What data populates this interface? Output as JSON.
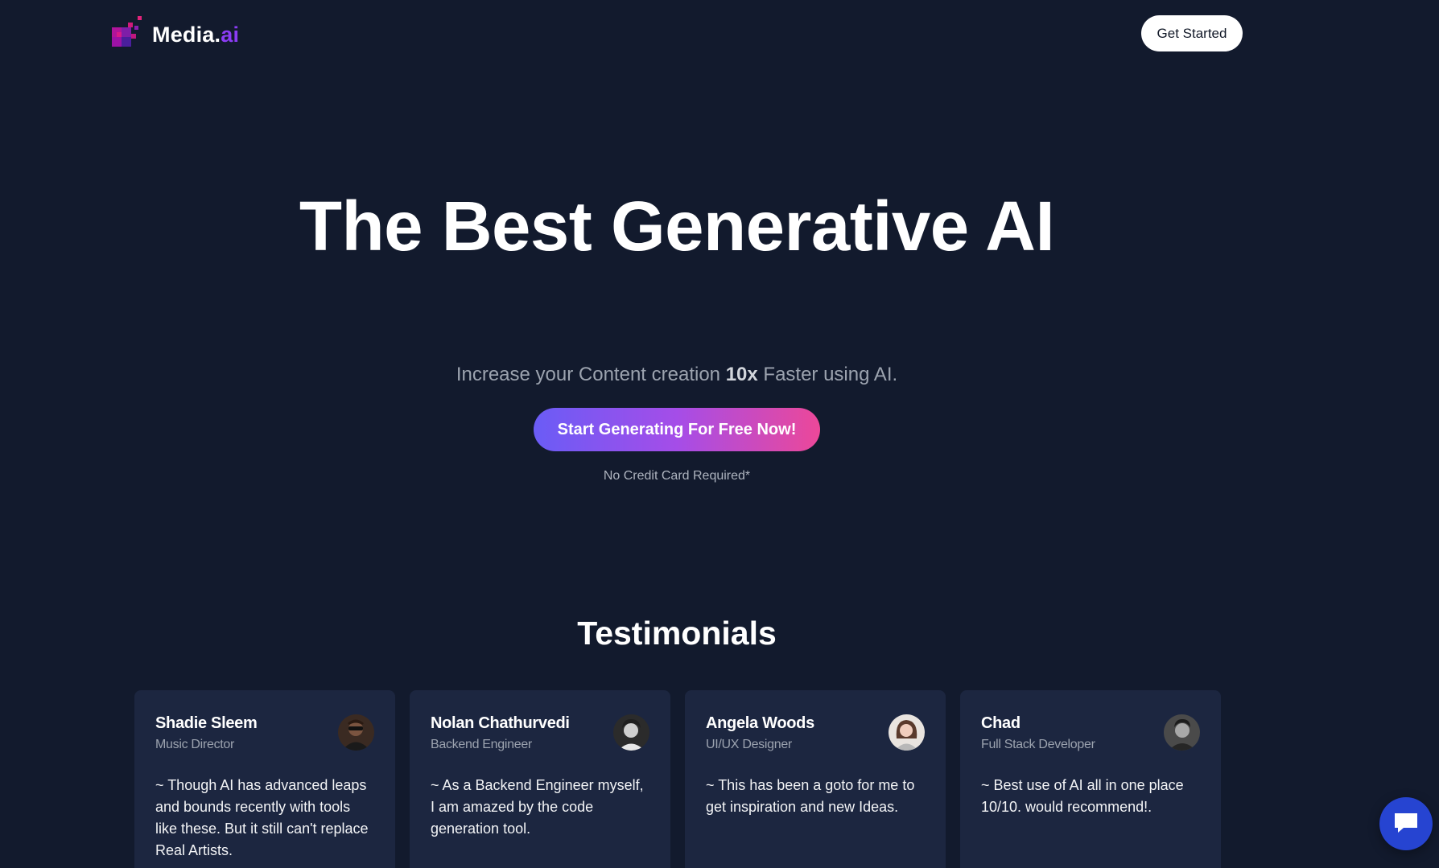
{
  "brand": {
    "name_main": "Media.",
    "name_accent": "ai",
    "accent_color": "#8b3cf5",
    "logo_icon": "pixel-logo-icon"
  },
  "header": {
    "get_started_label": "Get Started"
  },
  "hero": {
    "title": "The Best Generative AI",
    "subtitle_before": "Increase your Content creation ",
    "subtitle_bold": "10x",
    "subtitle_after": " Faster using AI.",
    "cta_label": "Start Generating For Free Now!",
    "cta_gradient": [
      "#6a5cf6",
      "#a54de8",
      "#ec4899"
    ],
    "note": "No Credit Card Required*"
  },
  "testimonials": {
    "title": "Testimonials",
    "items": [
      {
        "name": "Shadie Sleem",
        "role": "Music Director",
        "text": "~ Though AI has advanced leaps and bounds recently with tools like these. But it still can't replace Real Artists.",
        "avatar": "avatar-photo"
      },
      {
        "name": "Nolan Chathurvedi",
        "role": "Backend Engineer",
        "text": "~ As a Backend Engineer myself, I am amazed by the code generation tool.",
        "avatar": "avatar-photo"
      },
      {
        "name": "Angela Woods",
        "role": "UI/UX Designer",
        "text": "~ This has been a goto for me to get inspiration and new Ideas.",
        "avatar": "avatar-photo"
      },
      {
        "name": "Chad",
        "role": "Full Stack Developer",
        "text": "~ Best use of AI all in one place 10/10. would recommend!.",
        "avatar": "avatar-photo"
      }
    ]
  },
  "chat": {
    "icon": "chat-bubble-icon",
    "color": "#2644d1"
  },
  "colors": {
    "background": "#121a2d",
    "card": "#1c2640"
  }
}
